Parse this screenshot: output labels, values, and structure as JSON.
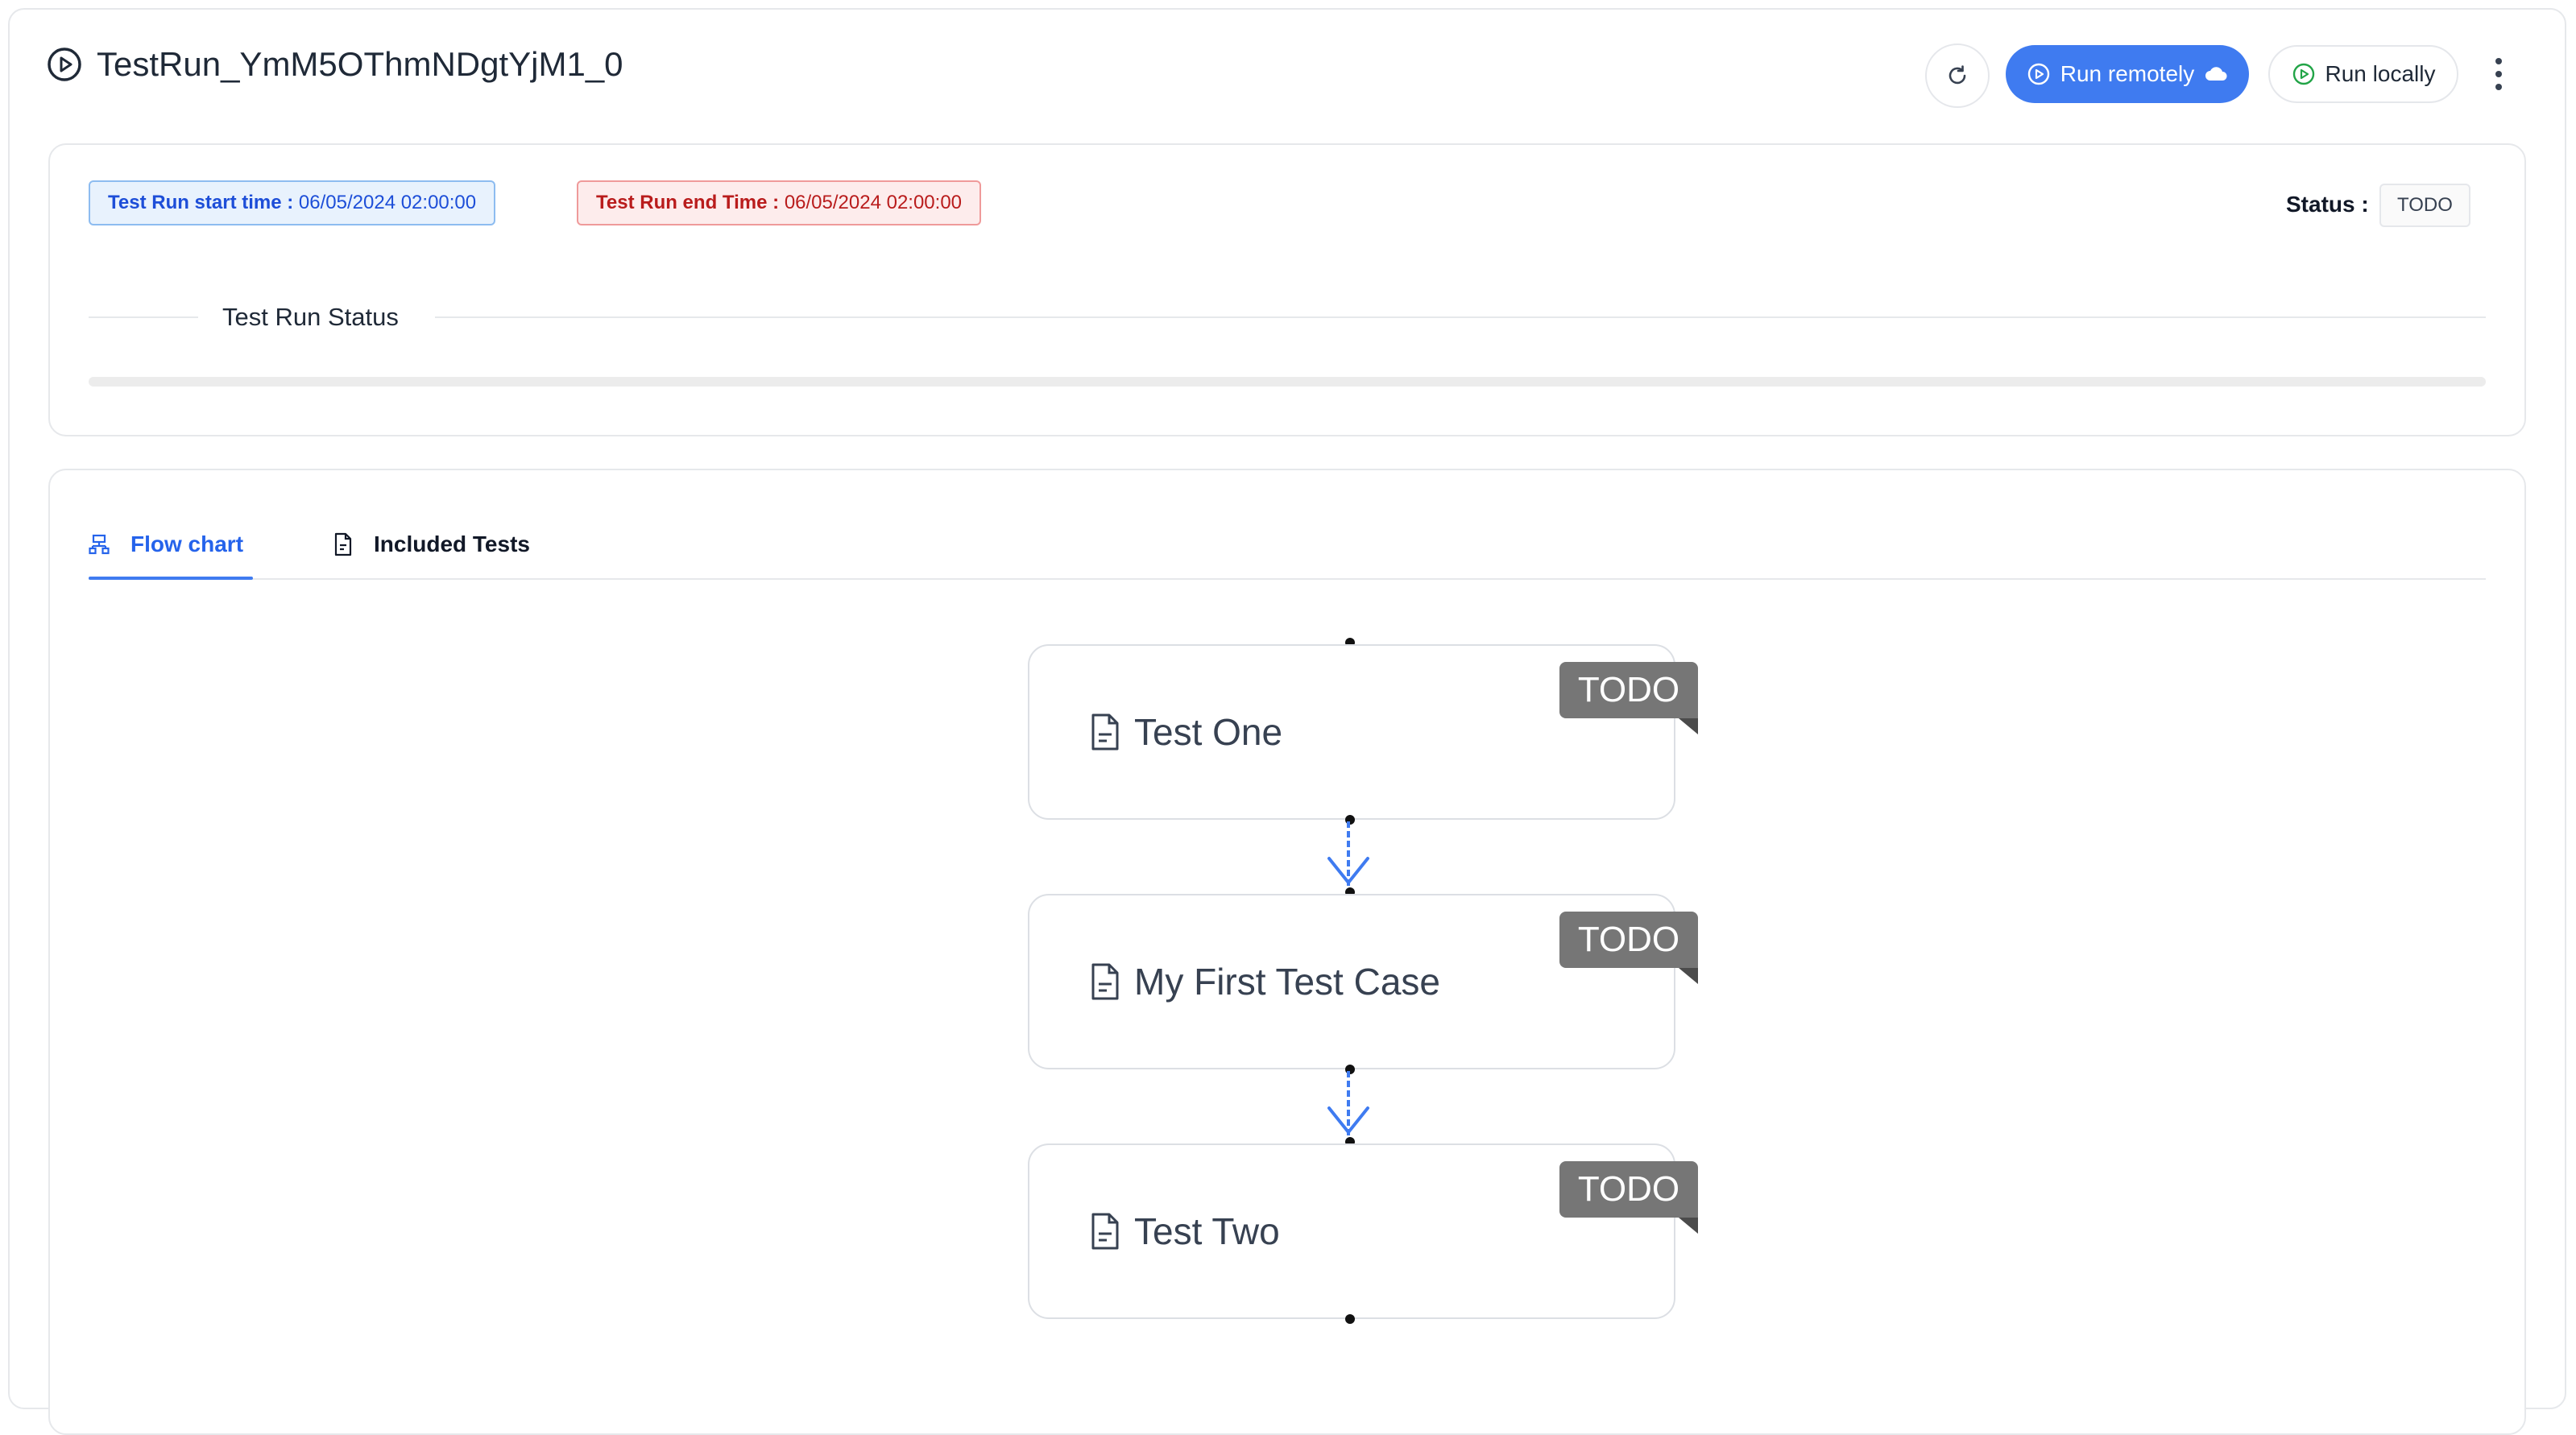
{
  "header": {
    "title": "TestRun_YmM5OThmNDgtYjM1_0",
    "run_remotely_label": "Run remotely",
    "run_locally_label": "Run locally"
  },
  "summary": {
    "start_time_label": "Test Run start time :",
    "start_time_value": "06/05/2024 02:00:00",
    "end_time_label": "Test Run end Time :",
    "end_time_value": "06/05/2024 02:00:00",
    "status_label": "Status :",
    "status_value": "TODO",
    "section_title": "Test Run Status",
    "progress_percent": 0
  },
  "tabs": [
    {
      "label": "Flow chart",
      "active": true
    },
    {
      "label": "Included Tests",
      "active": false
    }
  ],
  "flow": {
    "nodes": [
      {
        "label": "Test One",
        "status": "TODO"
      },
      {
        "label": "My First Test Case",
        "status": "TODO"
      },
      {
        "label": "Test Two",
        "status": "TODO"
      }
    ]
  },
  "colors": {
    "primary": "#3f7bf0",
    "run_locally_icon": "#22a447",
    "start_tag_bg": "#e8f2fd",
    "end_tag_bg": "#fdecec",
    "todo_ribbon": "#767676"
  },
  "icons": {
    "title": "play-circle-icon",
    "refresh": "refresh-icon",
    "run_remotely": "play-circle-icon",
    "cloud": "cloud-icon",
    "run_locally": "play-circle-icon",
    "more": "more-vertical-icon",
    "flow_tab": "flowchart-icon",
    "tests_tab": "document-icon",
    "node": "document-icon"
  }
}
